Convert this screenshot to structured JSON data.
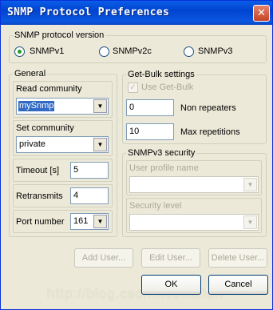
{
  "window": {
    "title": "SNMP Protocol Preferences",
    "close_glyph": "✕"
  },
  "version_group": {
    "legend": "SNMP protocol version",
    "options": [
      "SNMPv1",
      "SNMPv2c",
      "SNMPv3"
    ],
    "selected": "SNMPv1"
  },
  "general": {
    "legend": "General",
    "read_community": {
      "label": "Read community",
      "value": "mySnmp"
    },
    "set_community": {
      "label": "Set community",
      "value": "private"
    },
    "timeout": {
      "label": "Timeout [s]",
      "value": "5"
    },
    "retransmits": {
      "label": "Retransmits",
      "value": "4"
    },
    "port": {
      "label": "Port number",
      "value": "161"
    }
  },
  "getbulk": {
    "legend": "Get-Bulk settings",
    "use_label": "Use Get-Bulk",
    "use_checked": true,
    "non_repeaters": {
      "label": "Non repeaters",
      "value": "0"
    },
    "max_repetitions": {
      "label": "Max repetitions",
      "value": "10"
    }
  },
  "v3": {
    "legend": "SNMPv3 security",
    "user_profile_label": "User profile name",
    "user_profile_value": "",
    "security_level_label": "Security level",
    "security_level_value": ""
  },
  "buttons": {
    "add_user": "Add User...",
    "edit_user": "Edit User...",
    "delete_user": "Delete User...",
    "ok": "OK",
    "cancel": "Cancel"
  },
  "watermark": "http://blog.csdn.net/hailon",
  "icons": {
    "dropdown": "▼",
    "check": "✓"
  }
}
